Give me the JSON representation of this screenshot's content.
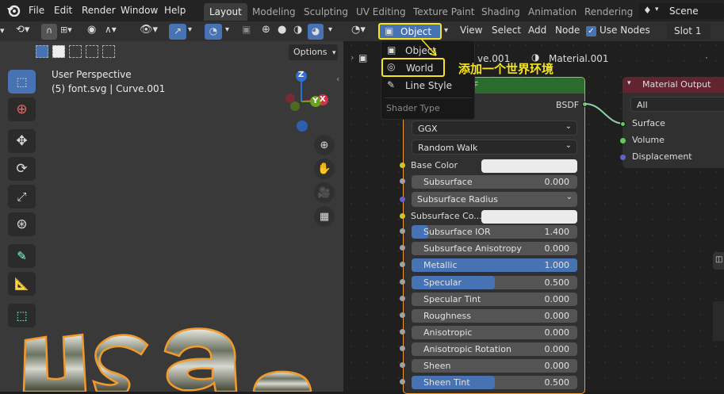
{
  "menu": [
    "File",
    "Edit",
    "Render",
    "Window",
    "Help"
  ],
  "workspaces": [
    "Layout",
    "Modeling",
    "Sculpting",
    "UV Editing",
    "Texture Paint",
    "Shading",
    "Animation",
    "Rendering"
  ],
  "active_workspace": "Layout",
  "scene_label": "Scene",
  "viewport": {
    "options_label": "Options",
    "title": "User Perspective",
    "subtitle": "(5) font.svg | Curve.001",
    "axis_x": "X",
    "axis_y": "Y",
    "axis_z": "Z",
    "tools": [
      "select-box-icon",
      "cursor-icon",
      "move-icon",
      "rotate-icon",
      "scale-icon",
      "transform-icon",
      "annotate-icon",
      "measure-icon",
      "add-cube-icon"
    ],
    "nav": [
      "zoom-icon",
      "hand-icon",
      "camera-icon",
      "grid-icon"
    ],
    "text_fragment": "usa"
  },
  "node_editor": {
    "shader_type_value": "Object",
    "header_items": [
      "View",
      "Select",
      "Add",
      "Node"
    ],
    "use_nodes_label": "Use Nodes",
    "use_nodes_checked": true,
    "slot_label": "Slot 1",
    "breadcrumb_object": "ve.001",
    "material_name": "Material.001",
    "annotation": "添加一个世界环境"
  },
  "dropdown": {
    "items": [
      "Object",
      "World",
      "Line Style"
    ],
    "footer": "Shader Type"
  },
  "bsdf_node": {
    "title_fragment": "F",
    "output_label": "BSDF",
    "distribution": "GGX",
    "subsurface_method": "Random Walk",
    "base_color_label": "Base Color",
    "subsurface_radius_label": "Subsurface Radius",
    "subsurface_color_label": "Subsurface Co...",
    "fields": [
      {
        "label": "Subsurface",
        "value": "0.000",
        "fill": 0
      },
      {
        "label": "Subsurface IOR",
        "value": "1.400",
        "fill": 0.1
      },
      {
        "label": "Subsurface Anisotropy",
        "value": "0.000",
        "fill": 0
      },
      {
        "label": "Metallic",
        "value": "1.000",
        "fill": 1
      },
      {
        "label": "Specular",
        "value": "0.500",
        "fill": 0.5
      },
      {
        "label": "Specular Tint",
        "value": "0.000",
        "fill": 0
      },
      {
        "label": "Roughness",
        "value": "0.000",
        "fill": 0
      },
      {
        "label": "Anisotropic",
        "value": "0.000",
        "fill": 0
      },
      {
        "label": "Anisotropic Rotation",
        "value": "0.000",
        "fill": 0
      },
      {
        "label": "Sheen",
        "value": "0.000",
        "fill": 0
      },
      {
        "label": "Sheen Tint",
        "value": "0.500",
        "fill": 0.5
      }
    ]
  },
  "material_output": {
    "title": "Material Output",
    "target": "All",
    "inputs": [
      "Surface",
      "Volume",
      "Displacement"
    ]
  },
  "colors": {
    "accent": "#4772b3",
    "highlight": "#f5e51a",
    "bsdf_header": "#2c6b2e",
    "output_header": "#62252f"
  }
}
